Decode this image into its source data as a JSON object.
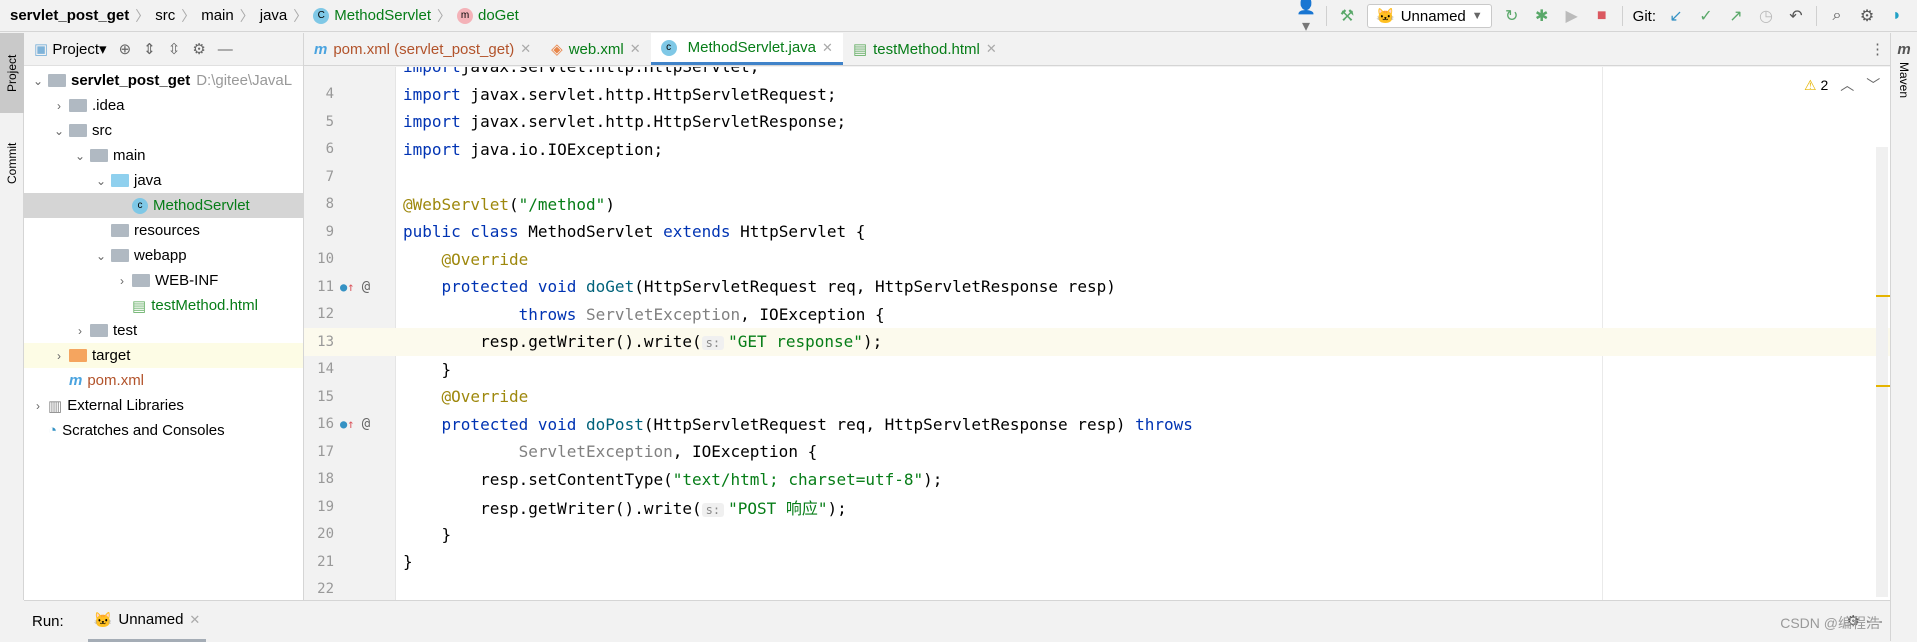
{
  "breadcrumb": {
    "project": "servlet_post_get",
    "items": [
      "src",
      "main",
      "java"
    ],
    "class": "MethodServlet",
    "class_icon": "C",
    "method": "doGet",
    "method_icon": "m"
  },
  "toolbar": {
    "run_config": "Unnamed",
    "git_label": "Git:"
  },
  "left_strip": {
    "project": "Project",
    "commit": "Commit"
  },
  "right_strip": {
    "maven": "Maven"
  },
  "project_panel": {
    "title": "Project",
    "tree": [
      {
        "label": "servlet_post_get",
        "path": "D:\\gitee\\JavaL",
        "level": 0,
        "arrow": "v",
        "type": "module",
        "bold": true
      },
      {
        "label": ".idea",
        "level": 1,
        "arrow": ">",
        "type": "folder"
      },
      {
        "label": "src",
        "level": 1,
        "arrow": "v",
        "type": "folder"
      },
      {
        "label": "main",
        "level": 2,
        "arrow": "v",
        "type": "folder"
      },
      {
        "label": "java",
        "level": 3,
        "arrow": "v",
        "type": "source-folder"
      },
      {
        "label": "MethodServlet",
        "level": 4,
        "arrow": "",
        "type": "class",
        "selected": true,
        "color": "#067d17"
      },
      {
        "label": "resources",
        "level": 3,
        "arrow": "",
        "type": "resources-folder"
      },
      {
        "label": "webapp",
        "level": 3,
        "arrow": "v",
        "type": "folder"
      },
      {
        "label": "WEB-INF",
        "level": 4,
        "arrow": ">",
        "type": "folder"
      },
      {
        "label": "testMethod.html",
        "level": 4,
        "arrow": "",
        "type": "html",
        "color": "#067d17"
      },
      {
        "label": "test",
        "level": 2,
        "arrow": ">",
        "type": "folder"
      },
      {
        "label": "target",
        "level": 1,
        "arrow": ">",
        "type": "excluded-folder",
        "highlight": true
      },
      {
        "label": "pom.xml",
        "level": 1,
        "arrow": "",
        "type": "maven",
        "color": "#b2532b"
      },
      {
        "label": "External Libraries",
        "level": 0,
        "arrow": ">",
        "type": "libraries"
      },
      {
        "label": "Scratches and Consoles",
        "level": 0,
        "arrow": "",
        "type": "scratches"
      }
    ]
  },
  "tabs": [
    {
      "label": "pom.xml (servlet_post_get)",
      "icon": "m",
      "color": "#b2532b"
    },
    {
      "label": "web.xml",
      "icon": "xml",
      "color": "#067d17"
    },
    {
      "label": "MethodServlet.java",
      "icon": "C",
      "color": "#067d17",
      "active": true
    },
    {
      "label": "testMethod.html",
      "icon": "H",
      "color": "#067d17"
    }
  ],
  "inspection": {
    "warnings": "2"
  },
  "code": [
    {
      "n": "",
      "t": [
        [
          "kw",
          "import"
        ],
        [
          "",
          "javax.servlet.http.HttpServlet;"
        ]
      ]
    },
    {
      "n": "4",
      "t": [
        [
          "kw",
          "import"
        ],
        [
          "",
          " javax.servlet.http.HttpServletRequest;"
        ]
      ]
    },
    {
      "n": "5",
      "t": [
        [
          "kw",
          "import"
        ],
        [
          "",
          " javax.servlet.http.HttpServletResponse;"
        ]
      ]
    },
    {
      "n": "6",
      "t": [
        [
          "kw",
          "import"
        ],
        [
          "",
          " java.io.IOException;"
        ]
      ]
    },
    {
      "n": "7",
      "t": []
    },
    {
      "n": "8",
      "t": [
        [
          "ann",
          "@WebServlet"
        ],
        [
          "",
          "("
        ],
        [
          "str",
          "\"/method\""
        ],
        [
          "",
          ")"
        ]
      ]
    },
    {
      "n": "9",
      "t": [
        [
          "kw",
          "public class"
        ],
        [
          "",
          " MethodServlet "
        ],
        [
          "kw",
          "extends"
        ],
        [
          "",
          " HttpServlet {"
        ]
      ]
    },
    {
      "n": "10",
      "t": [
        [
          "",
          "    "
        ],
        [
          "ann",
          "@Override"
        ]
      ]
    },
    {
      "n": "11",
      "g": "override",
      "t": [
        [
          "",
          "    "
        ],
        [
          "kw",
          "protected void"
        ],
        [
          "",
          " "
        ],
        [
          "fn",
          "doGet"
        ],
        [
          "",
          "(HttpServletRequest req, HttpServletResponse resp)"
        ]
      ]
    },
    {
      "n": "12",
      "t": [
        [
          "",
          "            "
        ],
        [
          "kw",
          "throws"
        ],
        [
          "",
          " "
        ],
        [
          "grey",
          "ServletException"
        ],
        [
          "",
          ", IOException {"
        ]
      ]
    },
    {
      "n": "13",
      "cur": true,
      "t": [
        [
          "",
          "        resp.getWriter().write("
        ],
        [
          "hint",
          "s:"
        ],
        [
          "str",
          "\"GET response\""
        ],
        [
          "",
          ");"
        ]
      ]
    },
    {
      "n": "14",
      "t": [
        [
          "",
          "    }"
        ]
      ]
    },
    {
      "n": "15",
      "t": [
        [
          "",
          "    "
        ],
        [
          "ann",
          "@Override"
        ]
      ]
    },
    {
      "n": "16",
      "g": "override",
      "t": [
        [
          "",
          "    "
        ],
        [
          "kw",
          "protected void"
        ],
        [
          "",
          " "
        ],
        [
          "fn",
          "doPost"
        ],
        [
          "",
          "(HttpServletRequest req, HttpServletResponse resp) "
        ],
        [
          "kw",
          "throws"
        ]
      ]
    },
    {
      "n": "17",
      "t": [
        [
          "",
          "            "
        ],
        [
          "grey",
          "ServletException"
        ],
        [
          "",
          ", IOException {"
        ]
      ]
    },
    {
      "n": "18",
      "t": [
        [
          "",
          "        resp.setContentType("
        ],
        [
          "str",
          "\"text/html; charset=utf-8\""
        ],
        [
          "",
          ");"
        ]
      ]
    },
    {
      "n": "19",
      "t": [
        [
          "",
          "        resp.getWriter().write("
        ],
        [
          "hint",
          "s:"
        ],
        [
          "str",
          "\"POST 响应\""
        ],
        [
          "",
          ");"
        ]
      ]
    },
    {
      "n": "20",
      "t": [
        [
          "",
          "    }"
        ]
      ]
    },
    {
      "n": "21",
      "t": [
        [
          "",
          "}"
        ]
      ]
    },
    {
      "n": "22",
      "t": []
    }
  ],
  "run": {
    "label": "Run:",
    "tab": "Unnamed"
  },
  "watermark": "CSDN @编程浩"
}
